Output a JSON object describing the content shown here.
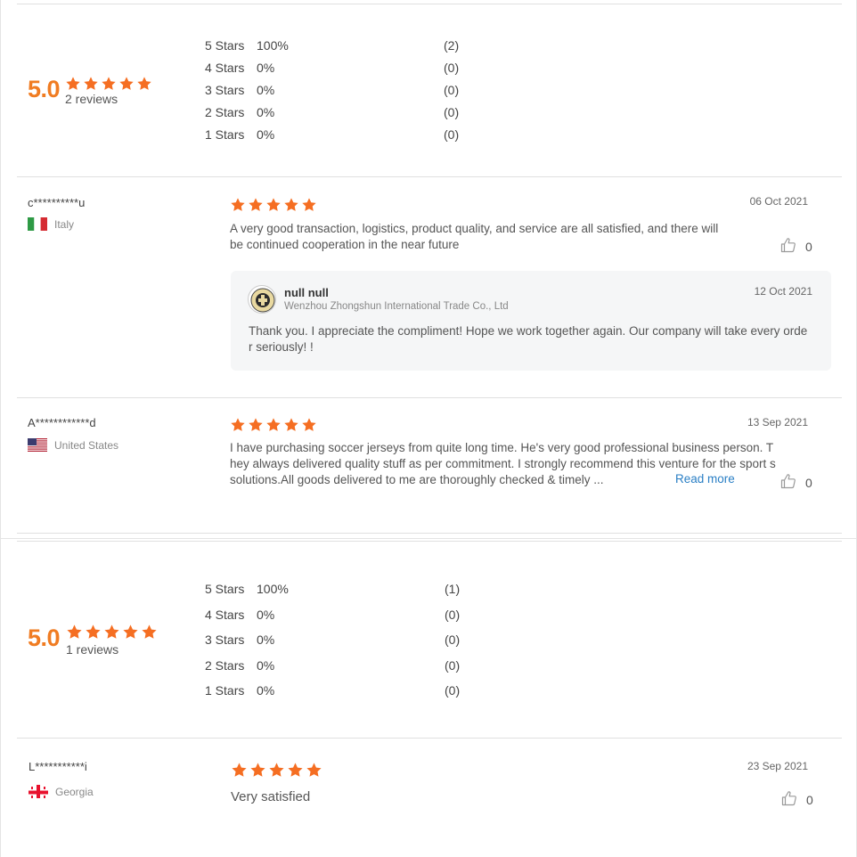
{
  "colors": {
    "star": "#f56e22",
    "score": "#f07c22",
    "link": "#2a7fc5"
  },
  "section1": {
    "score": "5.0",
    "rating_stars": 5,
    "review_count": "2 reviews",
    "distribution": [
      {
        "label": "5  Stars",
        "pct": "100%",
        "count": "(2)"
      },
      {
        "label": "4  Stars",
        "pct": "0%",
        "count": "(0)"
      },
      {
        "label": "3  Stars",
        "pct": "0%",
        "count": "(0)"
      },
      {
        "label": "2  Stars",
        "pct": "0%",
        "count": "(0)"
      },
      {
        "label": "1  Stars",
        "pct": "0%",
        "count": "(0)"
      }
    ],
    "reviews": [
      {
        "name": "c**********u",
        "country": "Italy",
        "flag_icon": "italy-flag-icon",
        "stars": 5,
        "date": "06 Oct 2021",
        "text": "A very good transaction, logistics, product quality, and service are all satisfied, and there will be continued cooperation in the near future",
        "likes": "0",
        "reply": {
          "name": "null null",
          "company": "Wenzhou Zhongshun International Trade Co., Ltd",
          "date": "12 Oct 2021",
          "text": "Thank you. I appreciate the compliment! Hope we work together again. Our company will take every orde r seriously! !"
        }
      },
      {
        "name": "A************d",
        "country": "United States",
        "flag_icon": "us-flag-icon",
        "stars": 5,
        "date": "13 Sep 2021",
        "text": "I have purchasing soccer jerseys from quite long time. He's very good professional business person. T hey always delivered quality stuff as per commitment. I strongly recommend this venture for the sport s solutions.All goods delivered to me are thoroughly checked & timely ...",
        "read_more": "Read more",
        "likes": "0"
      }
    ]
  },
  "section2": {
    "score": "5.0",
    "rating_stars": 5,
    "review_count": "1 reviews",
    "distribution": [
      {
        "label": "5  Stars",
        "pct": "100%",
        "count": "(1)"
      },
      {
        "label": "4  Stars",
        "pct": "0%",
        "count": "(0)"
      },
      {
        "label": "3  Stars",
        "pct": "0%",
        "count": "(0)"
      },
      {
        "label": "2  Stars",
        "pct": "0%",
        "count": "(0)"
      },
      {
        "label": "1  Stars",
        "pct": "0%",
        "count": "(0)"
      }
    ],
    "reviews": [
      {
        "name": "L***********i",
        "country": "Georgia",
        "flag_icon": "georgia-flag-icon",
        "stars": 5,
        "date": "23 Sep 2021",
        "text": "Very satisfied",
        "likes": "0"
      }
    ]
  }
}
